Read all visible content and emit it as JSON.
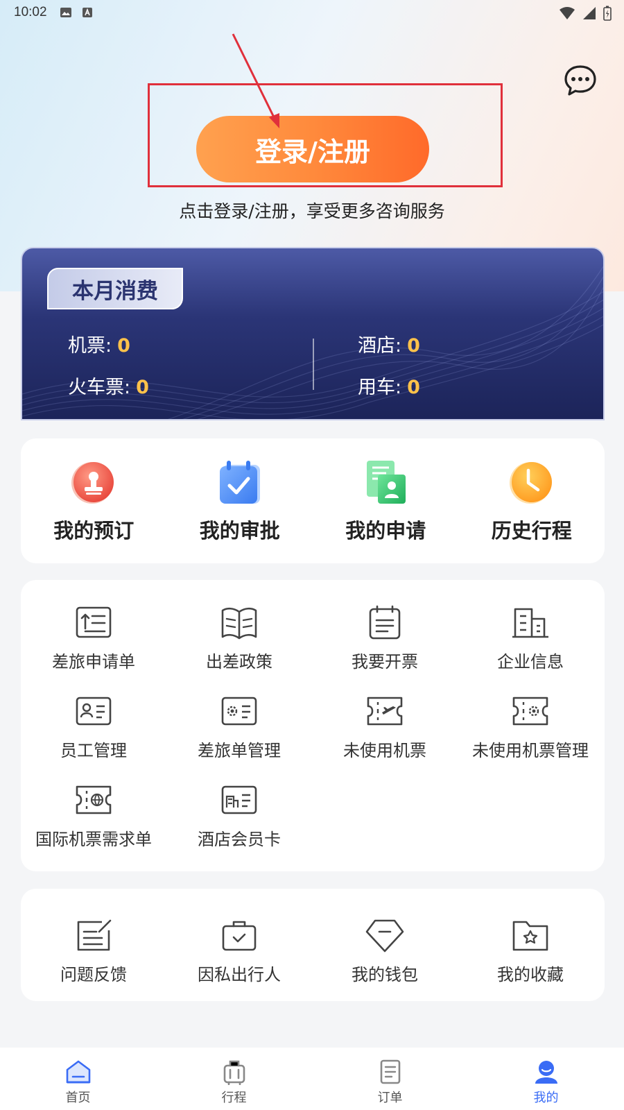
{
  "status_bar": {
    "time": "10:02"
  },
  "header": {
    "login_label": "登录/注册",
    "login_hint": "点击登录/注册，享受更多咨询服务"
  },
  "spend": {
    "title": "本月消费",
    "items": [
      {
        "label": "机票:",
        "value": "0"
      },
      {
        "label": "酒店:",
        "value": "0"
      },
      {
        "label": "火车票:",
        "value": "0"
      },
      {
        "label": "用车:",
        "value": "0"
      }
    ]
  },
  "main_actions": [
    {
      "label": "我的预订",
      "icon": "stamp-icon"
    },
    {
      "label": "我的审批",
      "icon": "calendar-check-icon"
    },
    {
      "label": "我的申请",
      "icon": "application-doc-icon"
    },
    {
      "label": "历史行程",
      "icon": "clock-icon"
    }
  ],
  "services": [
    {
      "label": "差旅申请单",
      "icon": "travel-form-icon"
    },
    {
      "label": "出差政策",
      "icon": "policy-book-icon"
    },
    {
      "label": "我要开票",
      "icon": "invoice-icon"
    },
    {
      "label": "企业信息",
      "icon": "building-icon"
    },
    {
      "label": "员工管理",
      "icon": "employee-card-icon"
    },
    {
      "label": "差旅单管理",
      "icon": "travel-manage-icon"
    },
    {
      "label": "未使用机票",
      "icon": "flight-ticket-icon"
    },
    {
      "label": "未使用机票管理",
      "icon": "ticket-settings-icon"
    },
    {
      "label": "国际机票需求单",
      "icon": "intl-ticket-icon"
    },
    {
      "label": "酒店会员卡",
      "icon": "hotel-card-icon"
    }
  ],
  "tools": [
    {
      "label": "问题反馈",
      "icon": "feedback-icon"
    },
    {
      "label": "因私出行人",
      "icon": "briefcase-icon"
    },
    {
      "label": "我的钱包",
      "icon": "wallet-icon"
    },
    {
      "label": "我的收藏",
      "icon": "favorite-folder-icon"
    }
  ],
  "tabs": [
    {
      "label": "首页",
      "icon": "home-icon",
      "active": false
    },
    {
      "label": "行程",
      "icon": "luggage-icon",
      "active": false
    },
    {
      "label": "订单",
      "icon": "order-icon",
      "active": false
    },
    {
      "label": "我的",
      "icon": "profile-icon",
      "active": true
    }
  ],
  "colors": {
    "accent_orange": "#ff7a35",
    "value_yellow": "#ffc24a",
    "active_tab": "#3a6cf5",
    "annotation_red": "#e0303b"
  }
}
